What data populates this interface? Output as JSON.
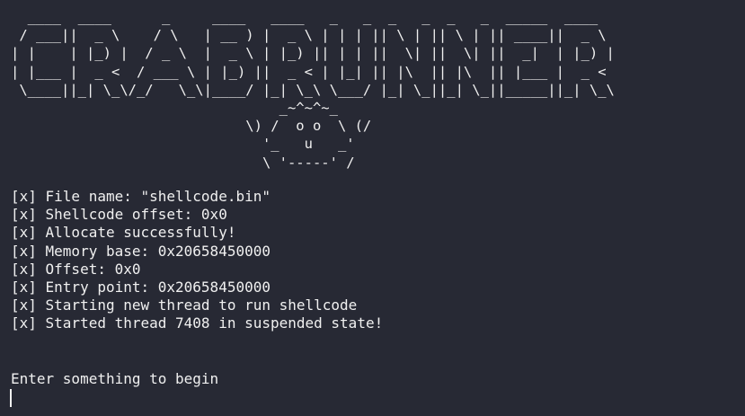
{
  "banner": {
    "ascii_art": "  ____  ____      _     ____   ____   _   _  _   _  _   _  _____  ____\n / ___||  _ \\    / \\   | __ ) |  _ \\ | | | || \\ | || \\ | || ____||  _ \\\n| |    | |_) |  / _ \\  |  _ \\ | |_) || | | ||  \\| ||  \\| ||  _|  | |_) |\n| |___ |  _ <  / ___ \\ | |_) ||  _ < | |_| || |\\  || |\\  || |___ |  _ <\n \\____||_| \\_\\/_/   \\_\\|____/ |_| \\_\\ \\___/ |_| \\_||_| \\_||_____||_| \\_\\\n                                _~^~^~_\n                            \\) /  o o  \\ (/\n                              '_   u   _'\n                              \\ '-----' /"
  },
  "log": [
    "[x] File name: \"shellcode.bin\"",
    "[x] Shellcode offset: 0x0",
    "[x] Allocate successfully!",
    "[x] Memory base: 0x20658450000",
    "[x] Offset: 0x0",
    "[x] Entry point: 0x20658450000",
    "[x] Starting new thread to run shellcode",
    "[x] Started thread 7408 in suspended state!"
  ],
  "prompt": "Enter something to begin"
}
